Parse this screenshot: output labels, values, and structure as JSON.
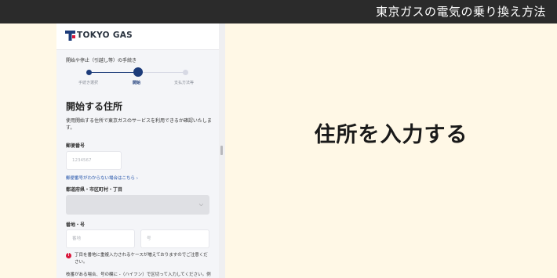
{
  "topbar": {
    "title": "東京ガスの電気の乗り換え方法"
  },
  "app": {
    "brand": "TOKYO GAS",
    "brand_color": "#1d3c7a",
    "accent_red": "#d9163a"
  },
  "stepper": {
    "title": "開始や停止（引越し等）の手続き",
    "steps": [
      {
        "label": "手続き選択",
        "state": "done"
      },
      {
        "label": "開始",
        "state": "current"
      },
      {
        "label": "支払方法等",
        "state": "upcoming"
      }
    ]
  },
  "form": {
    "section_title": "開始する住所",
    "description": "使用開始する住所で東京ガスのサービスを利用できるか確認いたします。",
    "postal": {
      "label": "郵便番号",
      "placeholder": "1234567",
      "help_link": "郵便番号がわからない場合はこちら"
    },
    "prefecture": {
      "label": "都道府県・市区町村・丁目",
      "value": ""
    },
    "address_number": {
      "label": "番地・号",
      "banchi_placeholder": "番地",
      "go_placeholder": "号"
    },
    "warning": "丁目を番地に重複入力されるケースが増えておりますのでご注意ください。",
    "note": "枝番がある場合、号の欄に -（ハイフン）で区切って入力してください。例"
  },
  "instruction": {
    "headline": "住所を入力する"
  }
}
